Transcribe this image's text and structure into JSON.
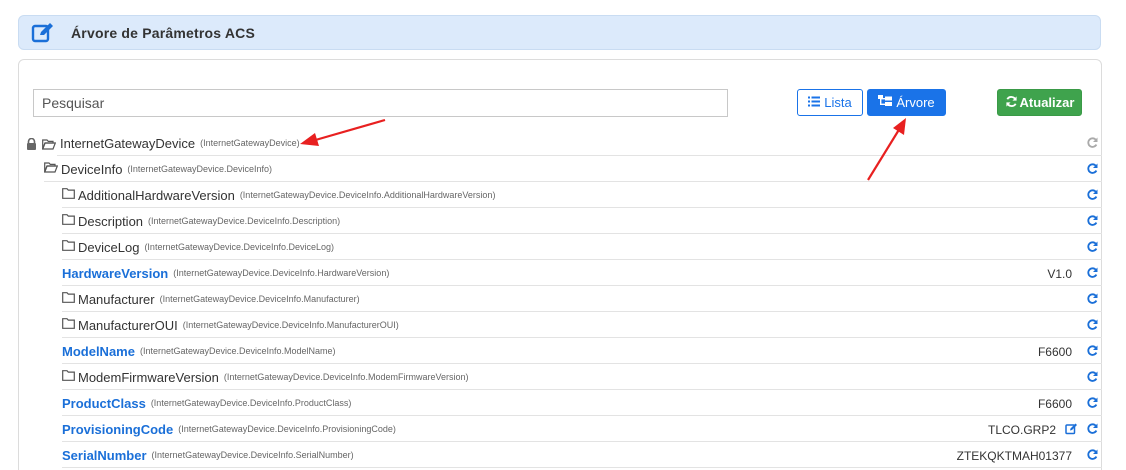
{
  "header": {
    "title": "Árvore de Parâmetros ACS",
    "icon": "edit-square-icon"
  },
  "toolbar": {
    "search_placeholder": "Pesquisar",
    "search_value": "",
    "lista_label": "Lista",
    "arvore_label": "Árvore",
    "atualizar_label": "Atualizar"
  },
  "colors": {
    "accent": "#1a73e8",
    "success": "#3fa34d",
    "header_bg": "#dceafb",
    "annotation": "#e82020"
  },
  "tree": {
    "root": {
      "name": "InternetGatewayDevice",
      "path": "(InternetGatewayDevice)",
      "icon": "folder-open-icon",
      "locked": true
    },
    "device_info": {
      "name": "DeviceInfo",
      "path": "(InternetGatewayDevice.DeviceInfo)",
      "icon": "folder-open-icon"
    },
    "items": [
      {
        "name": "AdditionalHardwareVersion",
        "path": "(InternetGatewayDevice.DeviceInfo.AdditionalHardwareVersion)",
        "type": "folder",
        "value": ""
      },
      {
        "name": "Description",
        "path": "(InternetGatewayDevice.DeviceInfo.Description)",
        "type": "folder",
        "value": ""
      },
      {
        "name": "DeviceLog",
        "path": "(InternetGatewayDevice.DeviceInfo.DeviceLog)",
        "type": "folder",
        "value": ""
      },
      {
        "name": "HardwareVersion",
        "path": "(InternetGatewayDevice.DeviceInfo.HardwareVersion)",
        "type": "leaf",
        "value": "V1.0"
      },
      {
        "name": "Manufacturer",
        "path": "(InternetGatewayDevice.DeviceInfo.Manufacturer)",
        "type": "folder",
        "value": ""
      },
      {
        "name": "ManufacturerOUI",
        "path": "(InternetGatewayDevice.DeviceInfo.ManufacturerOUI)",
        "type": "folder",
        "value": ""
      },
      {
        "name": "ModelName",
        "path": "(InternetGatewayDevice.DeviceInfo.ModelName)",
        "type": "leaf",
        "value": "F6600"
      },
      {
        "name": "ModemFirmwareVersion",
        "path": "(InternetGatewayDevice.DeviceInfo.ModemFirmwareVersion)",
        "type": "folder",
        "value": ""
      },
      {
        "name": "ProductClass",
        "path": "(InternetGatewayDevice.DeviceInfo.ProductClass)",
        "type": "leaf",
        "value": "F6600"
      },
      {
        "name": "ProvisioningCode",
        "path": "(InternetGatewayDevice.DeviceInfo.ProvisioningCode)",
        "type": "leaf",
        "value": "TLCO.GRP2",
        "editable": true
      },
      {
        "name": "SerialNumber",
        "path": "(InternetGatewayDevice.DeviceInfo.SerialNumber)",
        "type": "leaf",
        "value": "ZTEKQKTMAH01377"
      }
    ]
  }
}
